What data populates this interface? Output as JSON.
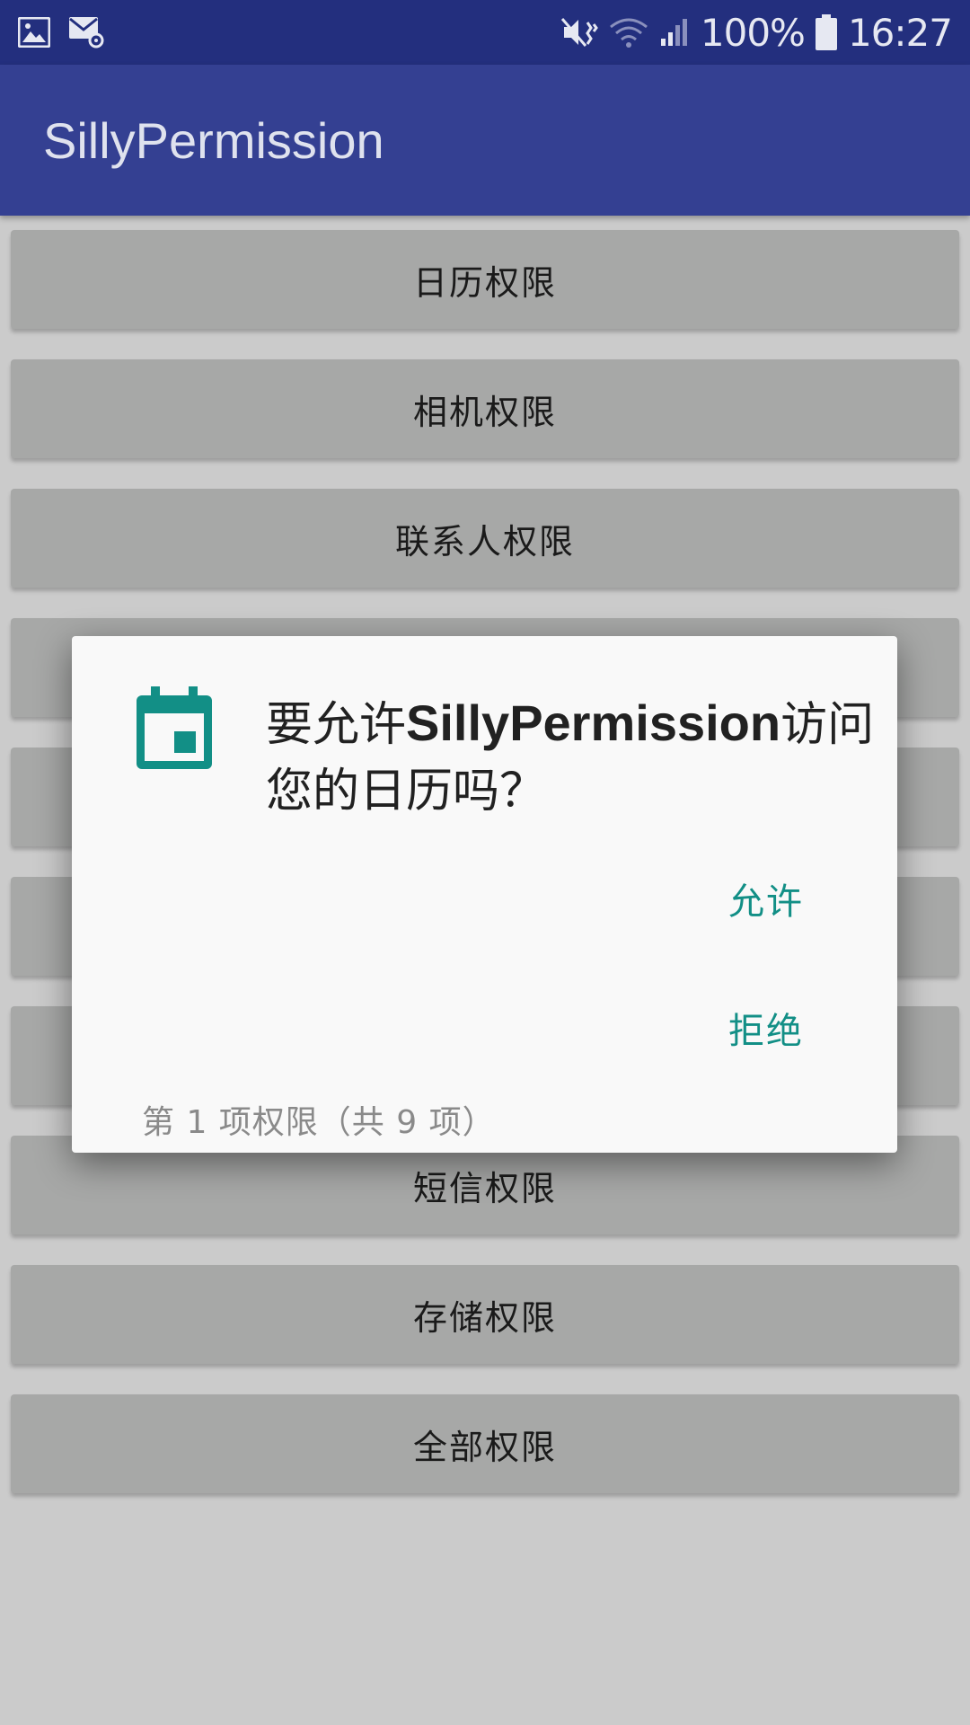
{
  "status_bar": {
    "icons_left": [
      "image-icon",
      "mail-settings-icon"
    ],
    "icons_right": [
      "mute-vibrate-icon",
      "wifi-icon",
      "signal-icon"
    ],
    "battery": "100%",
    "time": "16:27"
  },
  "app_bar": {
    "title": "SillyPermission"
  },
  "buttons": [
    {
      "label": "日历权限"
    },
    {
      "label": "相机权限"
    },
    {
      "label": "联系人权限"
    },
    {
      "label": ""
    },
    {
      "label": ""
    },
    {
      "label": ""
    },
    {
      "label": ""
    },
    {
      "label": "短信权限"
    },
    {
      "label": "存储权限"
    },
    {
      "label": "全部权限"
    }
  ],
  "dialog": {
    "icon": "calendar-icon",
    "message_prefix": "要允许",
    "message_app": "SillyPermission",
    "message_suffix": "访问您的日历吗？",
    "allow_label": "允许",
    "deny_label": "拒绝",
    "count_text": "第 1 项权限（共 9 项）",
    "accent_color": "#128f86"
  },
  "colors": {
    "status_bar": "#232f7e",
    "app_bar": "#344092",
    "background": "#cbcbcb",
    "button": "#a7a8a7"
  }
}
